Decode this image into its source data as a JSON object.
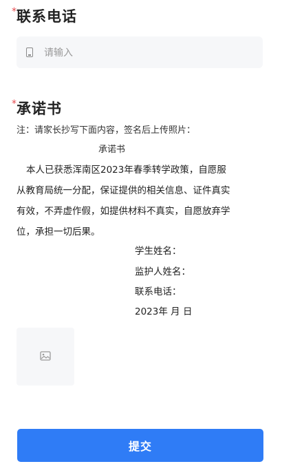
{
  "phone_section": {
    "label": "联系电话",
    "placeholder": "请输入"
  },
  "pledge_section": {
    "label": "承诺书",
    "notice": "注：请家长抄写下面内容，签名后上传照片：",
    "doc_title": "承诺书",
    "body_lines": [
      "本人已获悉浑南区2023年春季转学政策，自愿服",
      "从教育局统一分配，保证提供的相关信息、证件真实",
      "有效，不弄虚作假，如提供材料不真实，自愿放弃学",
      "位，承担一切后果。"
    ],
    "signature_fields": [
      "学生姓名：",
      "监护人姓名：",
      "联系电话：",
      "2023年 月 日"
    ]
  },
  "upload": {
    "icon": "image-icon"
  },
  "submit": {
    "label": "提交"
  },
  "colors": {
    "accent": "#2f7cf6",
    "required": "#e5484d",
    "input_bg": "#f6f7f9"
  }
}
